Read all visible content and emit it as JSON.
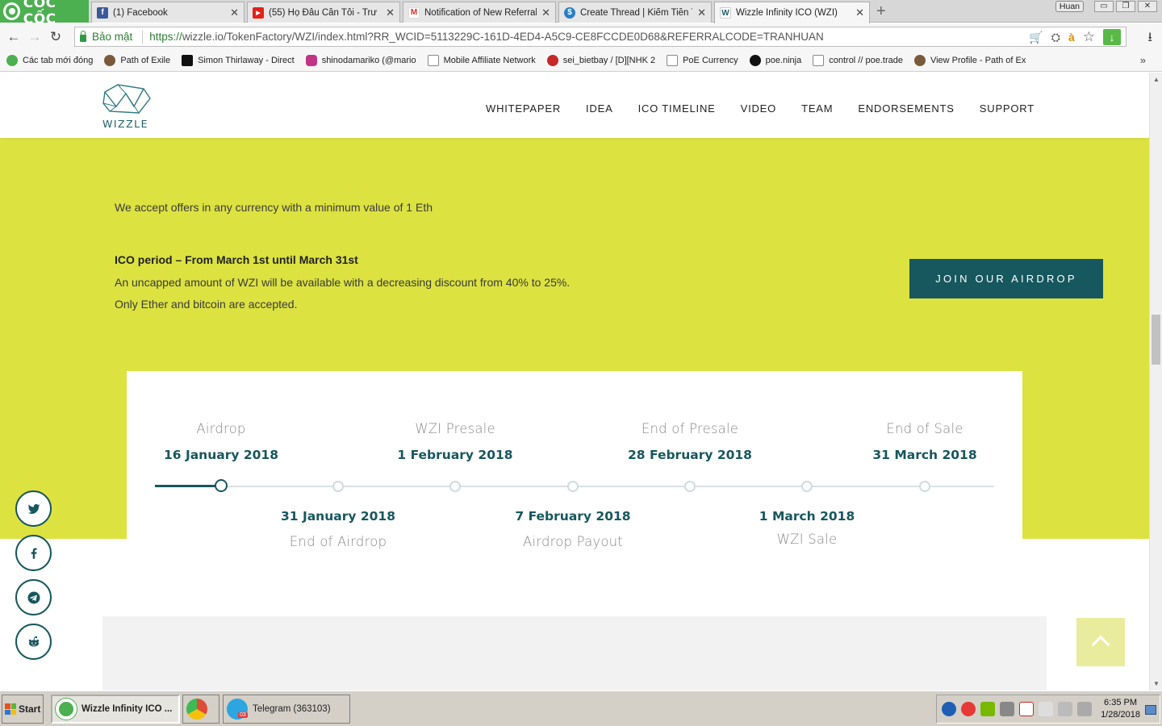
{
  "browser": {
    "brand": "CỐC CỐC",
    "tabs": [
      {
        "title": "(1) Facebook",
        "color": "#3b5998",
        "glyph": "f"
      },
      {
        "title": "(55) Họ Đâu Cần Tôi - Trư",
        "color": "#e62117",
        "glyph": "▶"
      },
      {
        "title": "Notification of New Referral",
        "color": "#d93025",
        "glyph": "M"
      },
      {
        "title": "Create Thread | Kiếm Tiền Trê",
        "color": "#2a7fc5",
        "glyph": "$"
      },
      {
        "title": "Wizzle Infinity ICO (WZI)",
        "color": "#1d5f66",
        "glyph": "W"
      }
    ],
    "new_tab": "+",
    "user": "Huan",
    "win_buttons": [
      "▭",
      "❐",
      "✕"
    ],
    "tab_close": "✕",
    "nav": {
      "back": "←",
      "forward": "→",
      "reload": "↻"
    },
    "secure_label": "Bảo mật",
    "url_scheme": "https://",
    "url_rest": "wizzle.io/TokenFactory/WZI/index.html?RR_WCID=5113229C-161D-4ED4-A5C9-CE8FCCDE0D68&REFERRALCODE=TRANHUAN",
    "omni_icons": {
      "cart": "🛒",
      "translate": "⛭",
      "lang": "à",
      "star": "☆",
      "download": "↓"
    },
    "download_arrow": "⭳",
    "bookmarks": [
      {
        "label": "Các tab mới đóng",
        "color": "#4caf50"
      },
      {
        "label": "Path of Exile",
        "color": "#7a5a3a"
      },
      {
        "label": "Simon Thirlaway - Direct",
        "color": "#111111"
      },
      {
        "label": "shinodamariko (@mario",
        "color": "#c13584"
      },
      {
        "label": "Mobile Affiliate Network",
        "color": "#eeeeee"
      },
      {
        "label": "sei_bietbay / [D][NHK 2",
        "color": "#c62828"
      },
      {
        "label": "PoE Currency",
        "color": "#eeeeee"
      },
      {
        "label": "poe.ninja",
        "color": "#111111"
      },
      {
        "label": "control // poe.trade",
        "color": "#eeeeee"
      },
      {
        "label": "View Profile - Path of Ex",
        "color": "#7a5a3a"
      }
    ],
    "bookmarks_more": "»"
  },
  "site": {
    "logo_text": "WIZZLE",
    "nav": [
      "WHITEPAPER",
      "IDEA",
      "ICO TIMELINE",
      "VIDEO",
      "TEAM",
      "ENDORSEMENTS",
      "SUPPORT"
    ],
    "offers_line": "We accept offers in any currency with a minimum value of 1 Eth",
    "ico_heading": "ICO period – From March 1st until March 31st",
    "ico_line1": "An uncapped amount of WZI will be available with a decreasing discount from 40% to 25%.",
    "ico_line2": "Only Ether and bitcoin are accepted.",
    "airdrop_button": "JOIN OUR AIRDROP",
    "timeline_top": [
      {
        "label": "Airdrop",
        "date": "16 January 2018"
      },
      {
        "label": "WZI Presale",
        "date": "1 February 2018"
      },
      {
        "label": "End of Presale",
        "date": "28 February 2018"
      },
      {
        "label": "End of Sale",
        "date": "31 March 2018"
      }
    ],
    "timeline_bottom": [
      {
        "date": "31 January 2018",
        "label": "End of Airdrop"
      },
      {
        "date": "7 February 2018",
        "label": "Airdrop Payout"
      },
      {
        "date": "1 March 2018",
        "label": "WZI Sale"
      }
    ],
    "colors": {
      "lime": "#dce240",
      "teal": "#17575e"
    },
    "social": [
      "twitter-icon",
      "facebook-icon",
      "telegram-icon",
      "reddit-icon"
    ]
  },
  "taskbar": {
    "start": "Start",
    "tasks": [
      {
        "title": "Wizzle Infinity ICO ...",
        "color": "#4caf50"
      },
      {
        "title": "",
        "color": "#dd4b39"
      },
      {
        "title": "Telegram (363103)",
        "color": "#2ca5e0"
      }
    ],
    "telegram_badge": "03",
    "clock_time": "6:35 PM",
    "clock_date": "1/28/2018"
  }
}
